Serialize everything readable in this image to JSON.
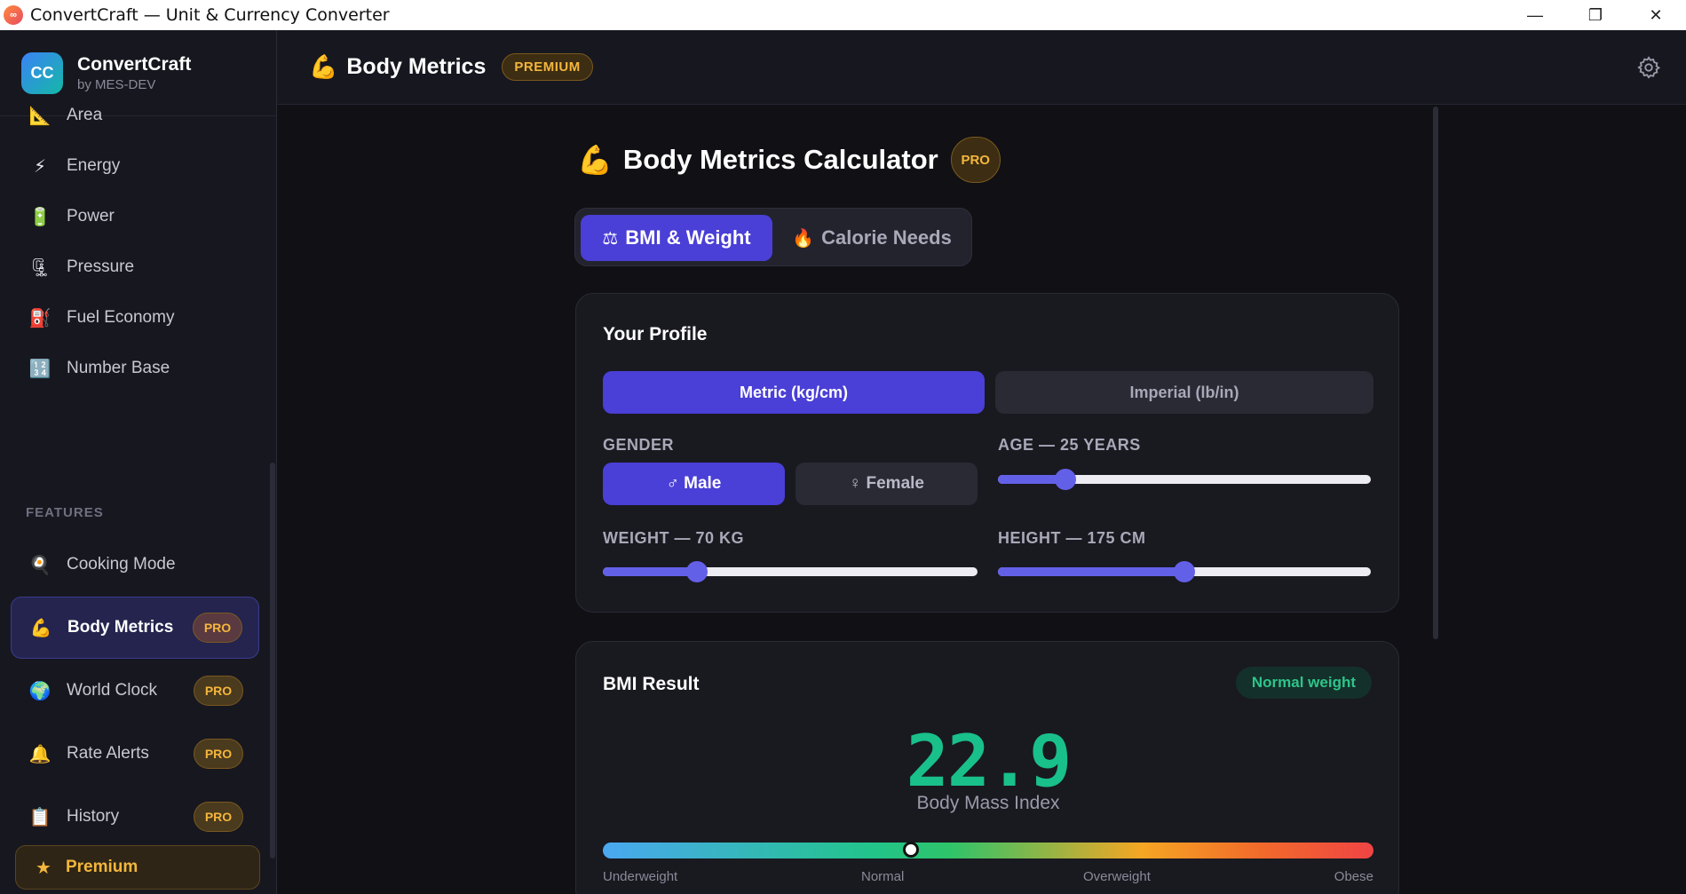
{
  "window": {
    "title": "ConvertCraft — Unit & Currency Converter",
    "minimize": "—",
    "restore": "❐",
    "close": "✕"
  },
  "brand": {
    "logo": "CC",
    "name": "ConvertCraft",
    "sub": "by MES-DEV"
  },
  "sidebar": {
    "items": [
      {
        "label": "Area",
        "icon": "ruler-triangle-icon",
        "glyph": "📐"
      },
      {
        "label": "Energy",
        "icon": "lightning-icon",
        "glyph": "⚡"
      },
      {
        "label": "Power",
        "icon": "battery-icon",
        "glyph": "🔋"
      },
      {
        "label": "Pressure",
        "icon": "clamp-icon",
        "glyph": "🗜"
      },
      {
        "label": "Fuel Economy",
        "icon": "fuel-pump-icon",
        "glyph": "⛽"
      },
      {
        "label": "Number Base",
        "icon": "numbers-icon",
        "glyph": "🔢"
      }
    ],
    "section_label": "FEATURES",
    "features": [
      {
        "label": "Cooking Mode",
        "icon": "frying-pan-icon",
        "glyph": "🍳"
      },
      {
        "label": "Body Metrics",
        "icon": "flexed-biceps-icon",
        "glyph": "💪",
        "badge": "PRO",
        "active": true
      },
      {
        "label": "World Clock",
        "icon": "globe-icon",
        "glyph": "🌍",
        "badge": "PRO"
      },
      {
        "label": "Rate Alerts",
        "icon": "bell-icon",
        "glyph": "🔔",
        "badge": "PRO"
      },
      {
        "label": "History",
        "icon": "clipboard-icon",
        "glyph": "📋",
        "badge": "PRO"
      }
    ],
    "premium": {
      "star": "★",
      "label": "Premium"
    }
  },
  "header": {
    "glyph": "💪",
    "title": "Body Metrics",
    "badge": "PREMIUM"
  },
  "calculator": {
    "glyph": "💪",
    "title": "Body Metrics Calculator",
    "badge": "PRO",
    "tabs": [
      {
        "glyph": "⚖",
        "label": "BMI & Weight",
        "active": true
      },
      {
        "glyph": "🔥",
        "label": "Calorie Needs",
        "active": false
      }
    ]
  },
  "profile": {
    "title": "Your Profile",
    "units": {
      "metric": "Metric (kg/cm)",
      "imperial": "Imperial (lb/in)",
      "selected": "metric"
    },
    "gender": {
      "label": "GENDER",
      "male": "♂ Male",
      "female": "♀ Female",
      "selected": "male"
    },
    "age": {
      "label": "AGE — 25 YEARS",
      "value": 25,
      "fraction": 0.18
    },
    "weight": {
      "label": "WEIGHT — 70 KG",
      "value": 70,
      "fraction": 0.25
    },
    "height": {
      "label": "HEIGHT — 175 CM",
      "value": 175,
      "fraction": 0.5
    }
  },
  "result": {
    "title": "BMI Result",
    "status": "Normal weight",
    "value": "22.9",
    "subtitle": "Body Mass Index",
    "marker_fraction": 0.4,
    "scale": [
      "Underweight",
      "Normal",
      "Overweight",
      "Obese"
    ]
  },
  "colors": {
    "accent": "#4a3fd6",
    "pro": "#f4b63c",
    "success": "#19c08a"
  }
}
